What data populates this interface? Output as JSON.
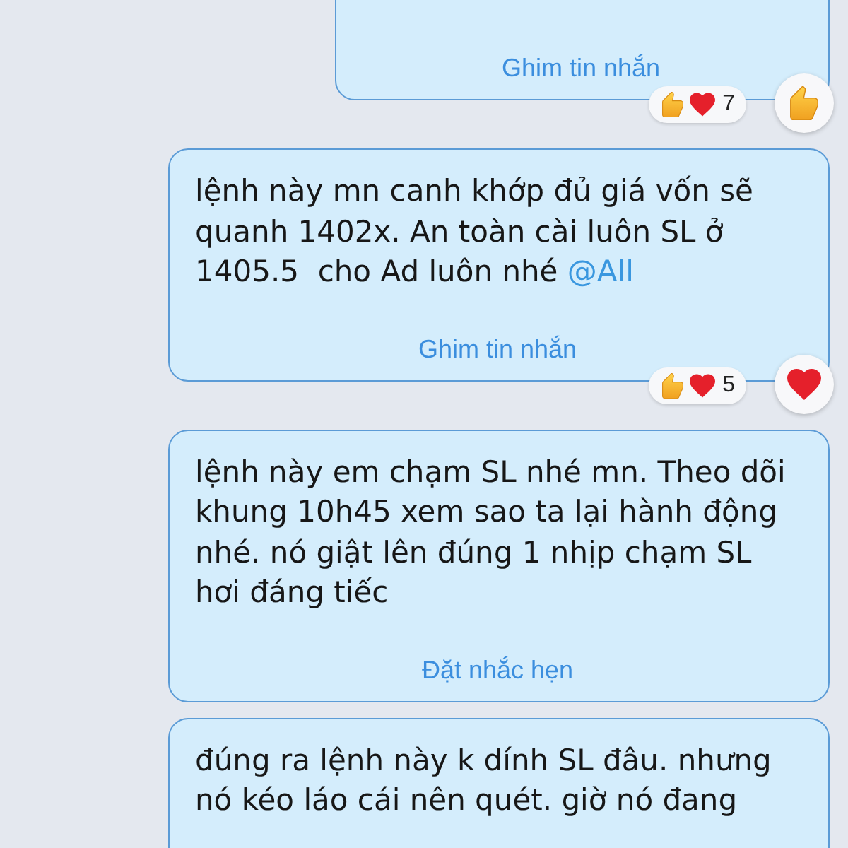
{
  "messages": [
    {
      "action": "Ghim tin nhắn",
      "reactions": {
        "items": [
          {
            "kind": "like"
          },
          {
            "kind": "heart"
          }
        ],
        "count": "7"
      },
      "my_reaction": {
        "kind": "like"
      }
    },
    {
      "text": "lệnh này mn canh khớp đủ giá vốn sẽ quanh 1402x. An toàn cài luôn SL ở 1405.5  cho Ad luôn nhé ",
      "mention": "@All",
      "action": "Ghim tin nhắn",
      "reactions": {
        "items": [
          {
            "kind": "like"
          },
          {
            "kind": "heart"
          }
        ],
        "count": "5"
      },
      "my_reaction": {
        "kind": "heart"
      }
    },
    {
      "text": "lệnh này em chạm SL nhé mn. Theo dõi khung 10h45 xem sao ta lại hành động nhé. nó giật lên đúng 1 nhịp chạm SL hơi đáng tiếc",
      "action": "Đặt nhắc hẹn"
    },
    {
      "text": "đúng ra lệnh này k dính SL đâu. nhưng nó kéo láo cái nên quét. giờ nó đang"
    }
  ]
}
